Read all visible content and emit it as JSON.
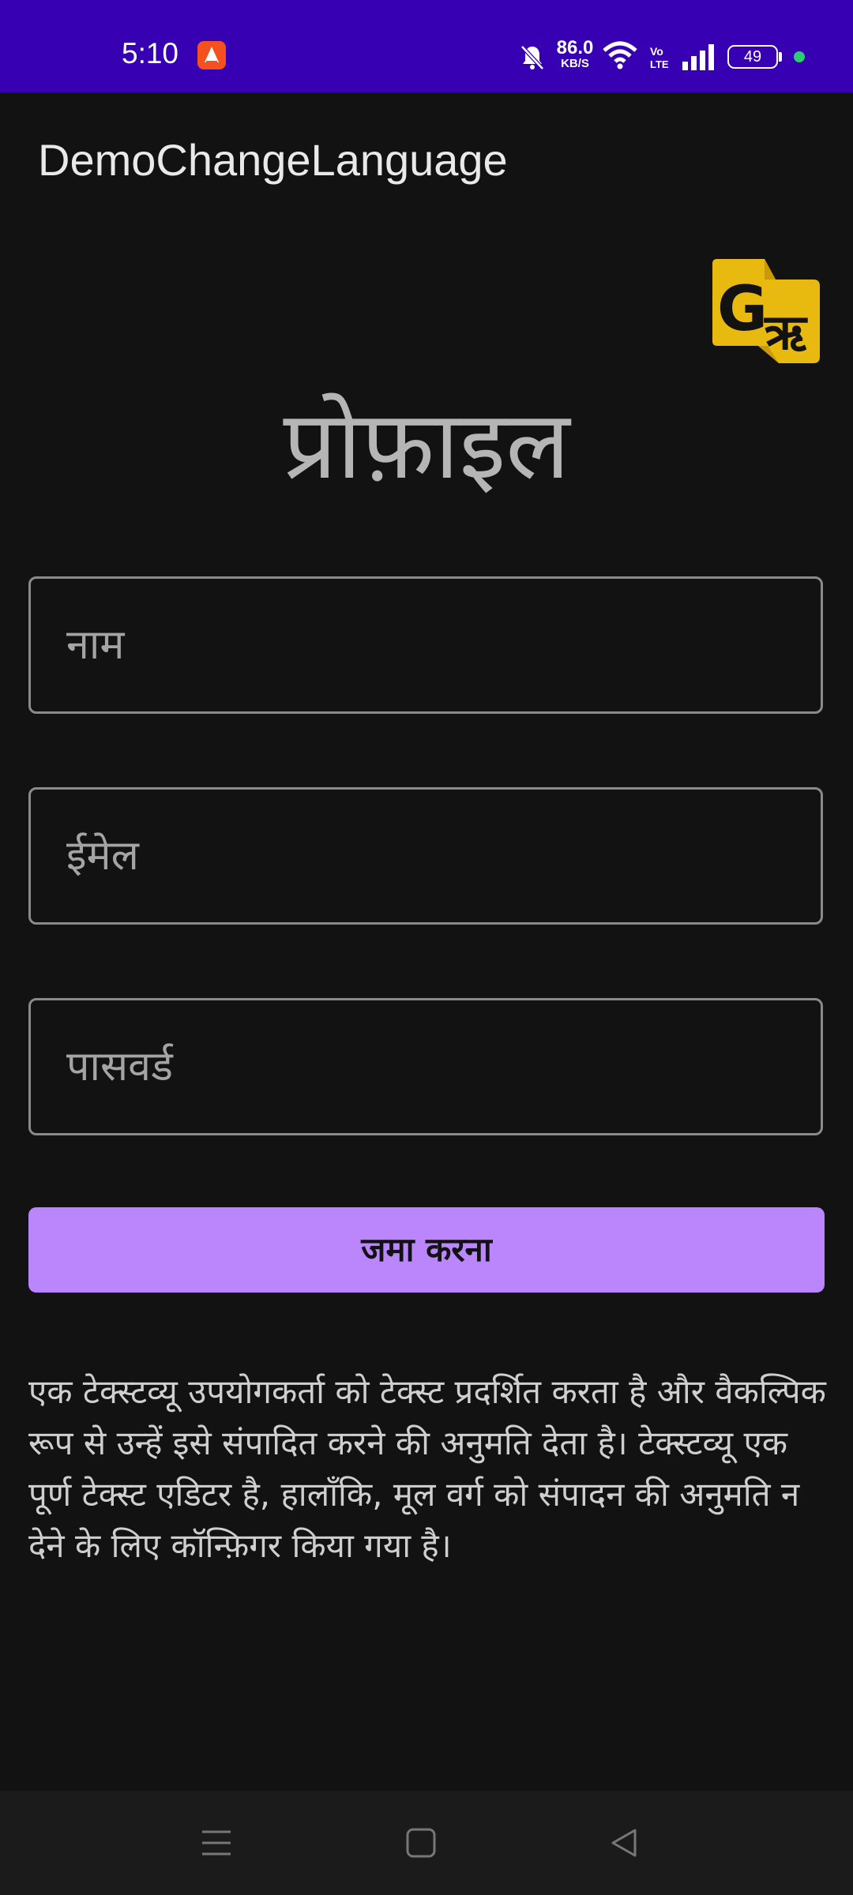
{
  "status_bar": {
    "time": "5:10",
    "net_speed_value": "86.0",
    "net_speed_unit": "KB/S",
    "volte_label": "Vo LTE",
    "battery_level": "49",
    "icons": [
      "app-notification-icon",
      "mute-icon",
      "wifi-icon",
      "volte-icon",
      "signal-icon",
      "battery-icon"
    ],
    "bar_color": "#3700B3",
    "dot_color": "#2ecc71"
  },
  "app_bar": {
    "title": "DemoChangeLanguage"
  },
  "translate_button": {
    "icon": "google-translate-icon",
    "color": "#E8B90E"
  },
  "form": {
    "heading": "प्रोफ़ाइल",
    "name_placeholder": "नाम",
    "email_placeholder": "ईमेल",
    "password_placeholder": "पासवर्ड",
    "submit_label": "जमा करना",
    "accent_color": "#BB86FC"
  },
  "description": "एक टेक्स्टव्यू उपयोगकर्ता को टेक्स्ट प्रदर्शित करता है और वैकल्पिक रूप से उन्हें इसे संपादित करने की अनुमति देता है। टेक्स्टव्यू एक पूर्ण टेक्स्ट एडिटर है, हालाँकि, मूल वर्ग को संपादन की अनुमति न देने के लिए कॉन्फ़िगर किया गया है।",
  "nav_bar": {
    "icons": [
      "menu-icon",
      "home-icon",
      "back-icon"
    ]
  }
}
